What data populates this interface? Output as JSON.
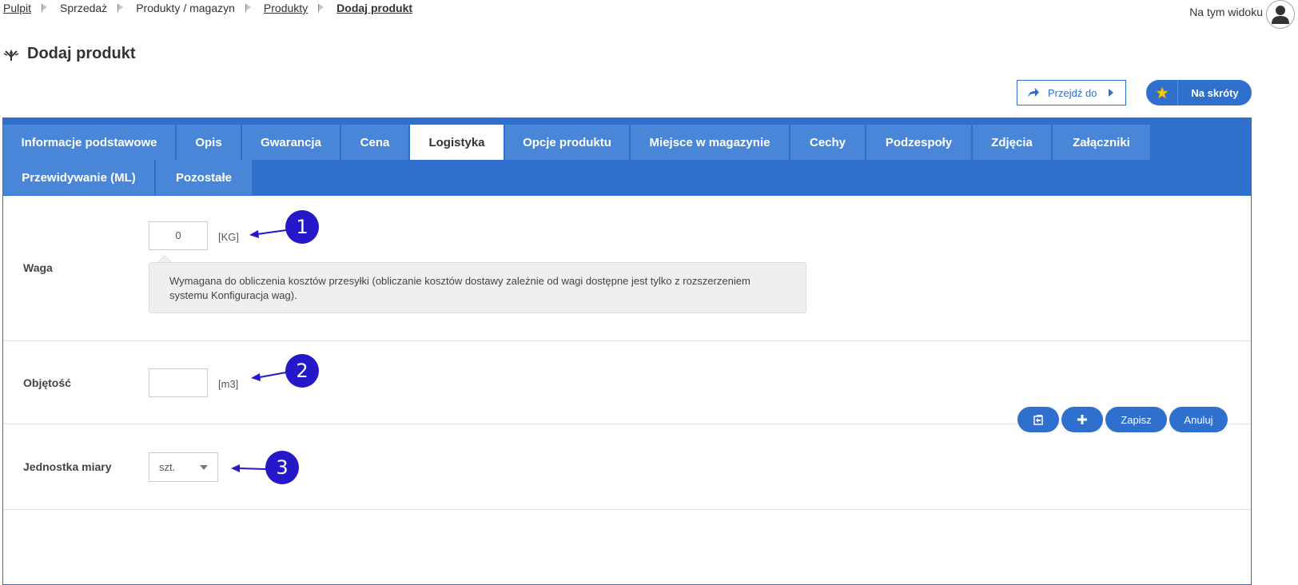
{
  "breadcrumb": {
    "items": [
      {
        "label": "Pulpit"
      },
      {
        "label": "Sprzedaż"
      },
      {
        "label": "Produkty / magazyn"
      },
      {
        "label": "Produkty"
      },
      {
        "label": "Dodaj produkt"
      }
    ]
  },
  "header": {
    "view_label": "Na tym widoku",
    "title": "Dodaj produkt",
    "goto_label": "Przejdź do",
    "shortcut_label": "Na skróty"
  },
  "tabs": {
    "row1": [
      {
        "label": "Informacje podstawowe"
      },
      {
        "label": "Opis"
      },
      {
        "label": "Gwarancja"
      },
      {
        "label": "Cena"
      },
      {
        "label": "Logistyka",
        "active": true
      },
      {
        "label": "Opcje produktu"
      },
      {
        "label": "Miejsce w magazynie"
      },
      {
        "label": "Cechy"
      },
      {
        "label": "Podzespoły"
      },
      {
        "label": "Zdjęcia"
      },
      {
        "label": "Załączniki"
      }
    ],
    "row2": [
      {
        "label": "Przewidywanie (ML)"
      },
      {
        "label": "Pozostałe"
      }
    ]
  },
  "form": {
    "weight": {
      "label": "Waga",
      "value": "0",
      "unit": "[KG]",
      "hint": "Wymagana do obliczenia kosztów przesyłki (obliczanie kosztów dostawy zależnie od wagi dostępne jest tylko z rozszerzeniem systemu Konfiguracja wag)."
    },
    "volume": {
      "label": "Objętość",
      "value": "",
      "unit": "[m3]"
    },
    "unit_of_measure": {
      "label": "Jednostka miary",
      "selected": "szt."
    }
  },
  "annotations": {
    "markers": [
      "1",
      "2",
      "3"
    ]
  },
  "footer": {
    "save_label": "Zapisz",
    "cancel_label": "Anuluj",
    "add_icon": "plus-icon",
    "return_icon": "return-icon"
  },
  "colors": {
    "primary": "#2f6fce",
    "tab": "#4a86d8",
    "marker": "#2418c9"
  }
}
